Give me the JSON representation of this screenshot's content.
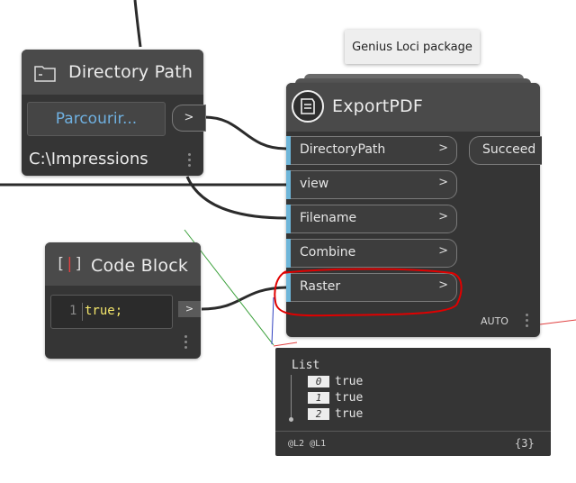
{
  "tooltip": {
    "text": "Genius Loci package"
  },
  "directory_node": {
    "title": "Directory Path",
    "browse_label": "Parcourir...",
    "path": "C:\\Impressions",
    "out_port": ">"
  },
  "export_node": {
    "title": "ExportPDF",
    "inputs": [
      {
        "label": "DirectoryPath",
        "chev": ">"
      },
      {
        "label": "view",
        "chev": ">"
      },
      {
        "label": "Filename",
        "chev": ">"
      },
      {
        "label": "Combine",
        "chev": ">"
      },
      {
        "label": "Raster",
        "chev": ">"
      }
    ],
    "output": "Succeed",
    "lacing": "AUTO"
  },
  "code_node": {
    "title": "Code Block",
    "line_number": "1",
    "code": "true;",
    "out_port": ">"
  },
  "preview": {
    "header": "List",
    "items": [
      {
        "index": "0",
        "value": "true"
      },
      {
        "index": "1",
        "value": "true"
      },
      {
        "index": "2",
        "value": "true"
      }
    ],
    "levels": "@L2 @L1",
    "count": "{3}"
  },
  "colors": {
    "canvas": "#ffffff",
    "node_body": "#353535",
    "node_header": "#4a4a4a",
    "port_accent": "#6eb6d9",
    "browse_text": "#6fb0e0",
    "annotation_red": "#e00000",
    "code_bracket": "#e04040",
    "code_text": "#f4e66b"
  }
}
